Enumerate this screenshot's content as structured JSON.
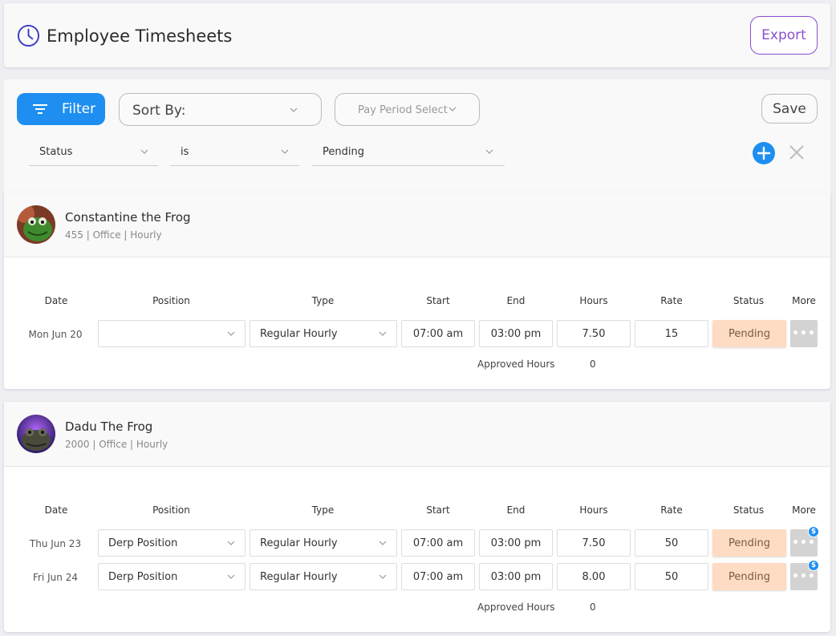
{
  "header": {
    "title": "Employee Timesheets",
    "export_label": "Export"
  },
  "toolbar": {
    "filter_label": "Filter",
    "sort_by_label": "Sort By:",
    "pay_period_label": "Pay Period Select",
    "save_label": "Save"
  },
  "filter_row": {
    "field": "Status",
    "operator": "is",
    "value": "Pending"
  },
  "columns": {
    "date": "Date",
    "position": "Position",
    "type": "Type",
    "start": "Start",
    "end": "End",
    "hours": "Hours",
    "rate": "Rate",
    "status": "Status",
    "more": "More"
  },
  "approved_hours_label": "Approved Hours",
  "employees": [
    {
      "name": "Constantine the Frog",
      "meta": "455 | Office | Hourly",
      "approved_hours": "0",
      "rows": [
        {
          "date": "Mon Jun 20",
          "position": "",
          "type": "Regular Hourly",
          "start": "07:00 am",
          "end": "03:00 pm",
          "hours": "7.50",
          "rate": "15",
          "status": "Pending",
          "badge": false
        }
      ]
    },
    {
      "name": "Dadu The Frog",
      "meta": "2000 | Office | Hourly",
      "approved_hours": "0",
      "rows": [
        {
          "date": "Thu Jun 23",
          "position": "Derp Position",
          "type": "Regular Hourly",
          "start": "07:00 am",
          "end": "03:00 pm",
          "hours": "7.50",
          "rate": "50",
          "status": "Pending",
          "badge": true,
          "badge_symbol": "$"
        },
        {
          "date": "Fri Jun 24",
          "position": "Derp Position",
          "type": "Regular Hourly",
          "start": "07:00 am",
          "end": "03:00 pm",
          "hours": "8.00",
          "rate": "50",
          "status": "Pending",
          "badge": true,
          "badge_symbol": "$"
        }
      ]
    }
  ],
  "colors": {
    "accent": "#1e8ff0",
    "export": "#8a4fd0",
    "pending": "#fddcc3"
  }
}
